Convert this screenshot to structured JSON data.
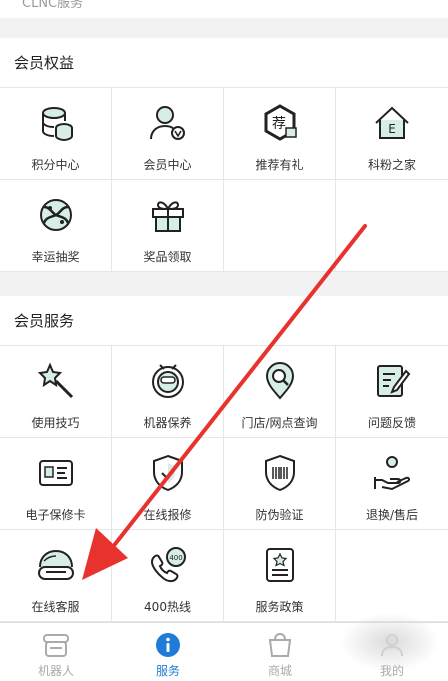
{
  "top_partial_text": "CLNC服务",
  "member_benefits": {
    "title": "会员权益",
    "items": [
      {
        "label": "积分中心",
        "icon": "points-database-icon"
      },
      {
        "label": "会员中心",
        "icon": "member-user-icon"
      },
      {
        "label": "推荐有礼",
        "icon": "recommend-gift-icon",
        "badge": "荐"
      },
      {
        "label": "科粉之家",
        "icon": "fan-home-icon",
        "badge": "E"
      },
      {
        "label": "幸运抽奖",
        "icon": "lucky-draw-icon"
      },
      {
        "label": "奖品领取",
        "icon": "prize-gift-icon"
      }
    ]
  },
  "member_services": {
    "title": "会员服务",
    "items": [
      {
        "label": "使用技巧",
        "icon": "magic-wand-icon"
      },
      {
        "label": "机器保养",
        "icon": "robot-maintenance-icon"
      },
      {
        "label": "门店/网点查询",
        "icon": "store-locator-icon"
      },
      {
        "label": "问题反馈",
        "icon": "feedback-edit-icon"
      },
      {
        "label": "电子保修卡",
        "icon": "warranty-card-icon"
      },
      {
        "label": "在线报修",
        "icon": "repair-shield-icon"
      },
      {
        "label": "防伪验证",
        "icon": "anti-counterfeit-icon"
      },
      {
        "label": "退换/售后",
        "icon": "return-hand-icon"
      },
      {
        "label": "在线客服",
        "icon": "online-service-icon"
      },
      {
        "label": "400热线",
        "icon": "hotline-phone-icon",
        "badge": "400"
      },
      {
        "label": "服务政策",
        "icon": "service-policy-icon"
      }
    ]
  },
  "tabbar": {
    "tabs": [
      {
        "label": "机器人",
        "icon": "robot-tab-icon",
        "active": false
      },
      {
        "label": "服务",
        "icon": "info-tab-icon",
        "active": true
      },
      {
        "label": "商城",
        "icon": "shop-bag-icon",
        "active": false
      },
      {
        "label": "我的",
        "icon": "profile-tab-icon",
        "active": false
      }
    ]
  },
  "colors": {
    "accent": "#1f7bd8",
    "icon_fill": "#d7eee6",
    "icon_stroke": "#222222",
    "arrow": "#e8322e"
  }
}
